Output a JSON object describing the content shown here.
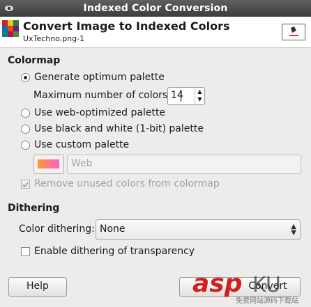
{
  "window": {
    "title": "Indexed Color Conversion"
  },
  "header": {
    "title": "Convert Image to Indexed Colors",
    "subtitle": "UxTechno.png-1"
  },
  "colormap": {
    "heading": "Colormap",
    "generate_label": "Generate optimum palette",
    "max_colors_label": "Maximum number of colors:",
    "max_colors_value": "14",
    "web_label": "Use web-optimized palette",
    "bw_label": "Use black and white (1-bit) palette",
    "custom_label": "Use custom palette",
    "palette_name": "Web",
    "remove_unused_label": "Remove unused colors from colormap"
  },
  "dithering": {
    "heading": "Dithering",
    "color_dithering_label": "Color dithering:",
    "color_dithering_value": "None",
    "transparency_label": "Enable dithering of transparency"
  },
  "buttons": {
    "help": "Help",
    "convert": "Convert"
  },
  "watermark": {
    "logo_text": "asp",
    "logo_text2": "KU",
    "sub_text": "免费网站源码下载站"
  }
}
